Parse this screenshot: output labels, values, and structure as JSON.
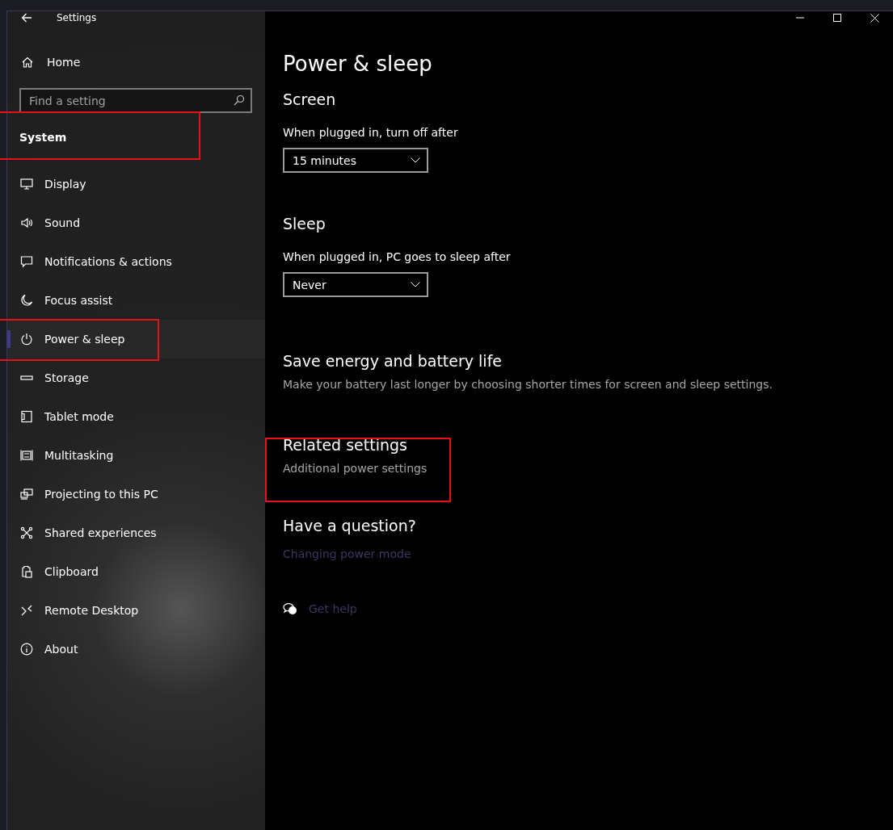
{
  "window": {
    "title": "Settings"
  },
  "sidebar": {
    "home": "Home",
    "search": {
      "placeholder": "Find a setting"
    },
    "section": "System",
    "items": [
      {
        "label": "Display",
        "selected": false
      },
      {
        "label": "Sound",
        "selected": false
      },
      {
        "label": "Notifications & actions",
        "selected": false
      },
      {
        "label": "Focus assist",
        "selected": false
      },
      {
        "label": "Power & sleep",
        "selected": true
      },
      {
        "label": "Storage",
        "selected": false
      },
      {
        "label": "Tablet mode",
        "selected": false
      },
      {
        "label": "Multitasking",
        "selected": false
      },
      {
        "label": "Projecting to this PC",
        "selected": false
      },
      {
        "label": "Shared experiences",
        "selected": false
      },
      {
        "label": "Clipboard",
        "selected": false
      },
      {
        "label": "Remote Desktop",
        "selected": false
      },
      {
        "label": "About",
        "selected": false
      }
    ]
  },
  "content": {
    "title": "Power & sleep",
    "screen": {
      "heading": "Screen",
      "label": "When plugged in, turn off after",
      "value": "15 minutes"
    },
    "sleep": {
      "heading": "Sleep",
      "label": "When plugged in, PC goes to sleep after",
      "value": "Never"
    },
    "save_energy": {
      "heading": "Save energy and battery life",
      "text": "Make your battery last longer by choosing shorter times for screen and sleep settings."
    },
    "related": {
      "heading": "Related settings",
      "link": "Additional power settings"
    },
    "question": {
      "heading": "Have a question?",
      "link": "Changing power mode",
      "help": "Get help"
    }
  }
}
